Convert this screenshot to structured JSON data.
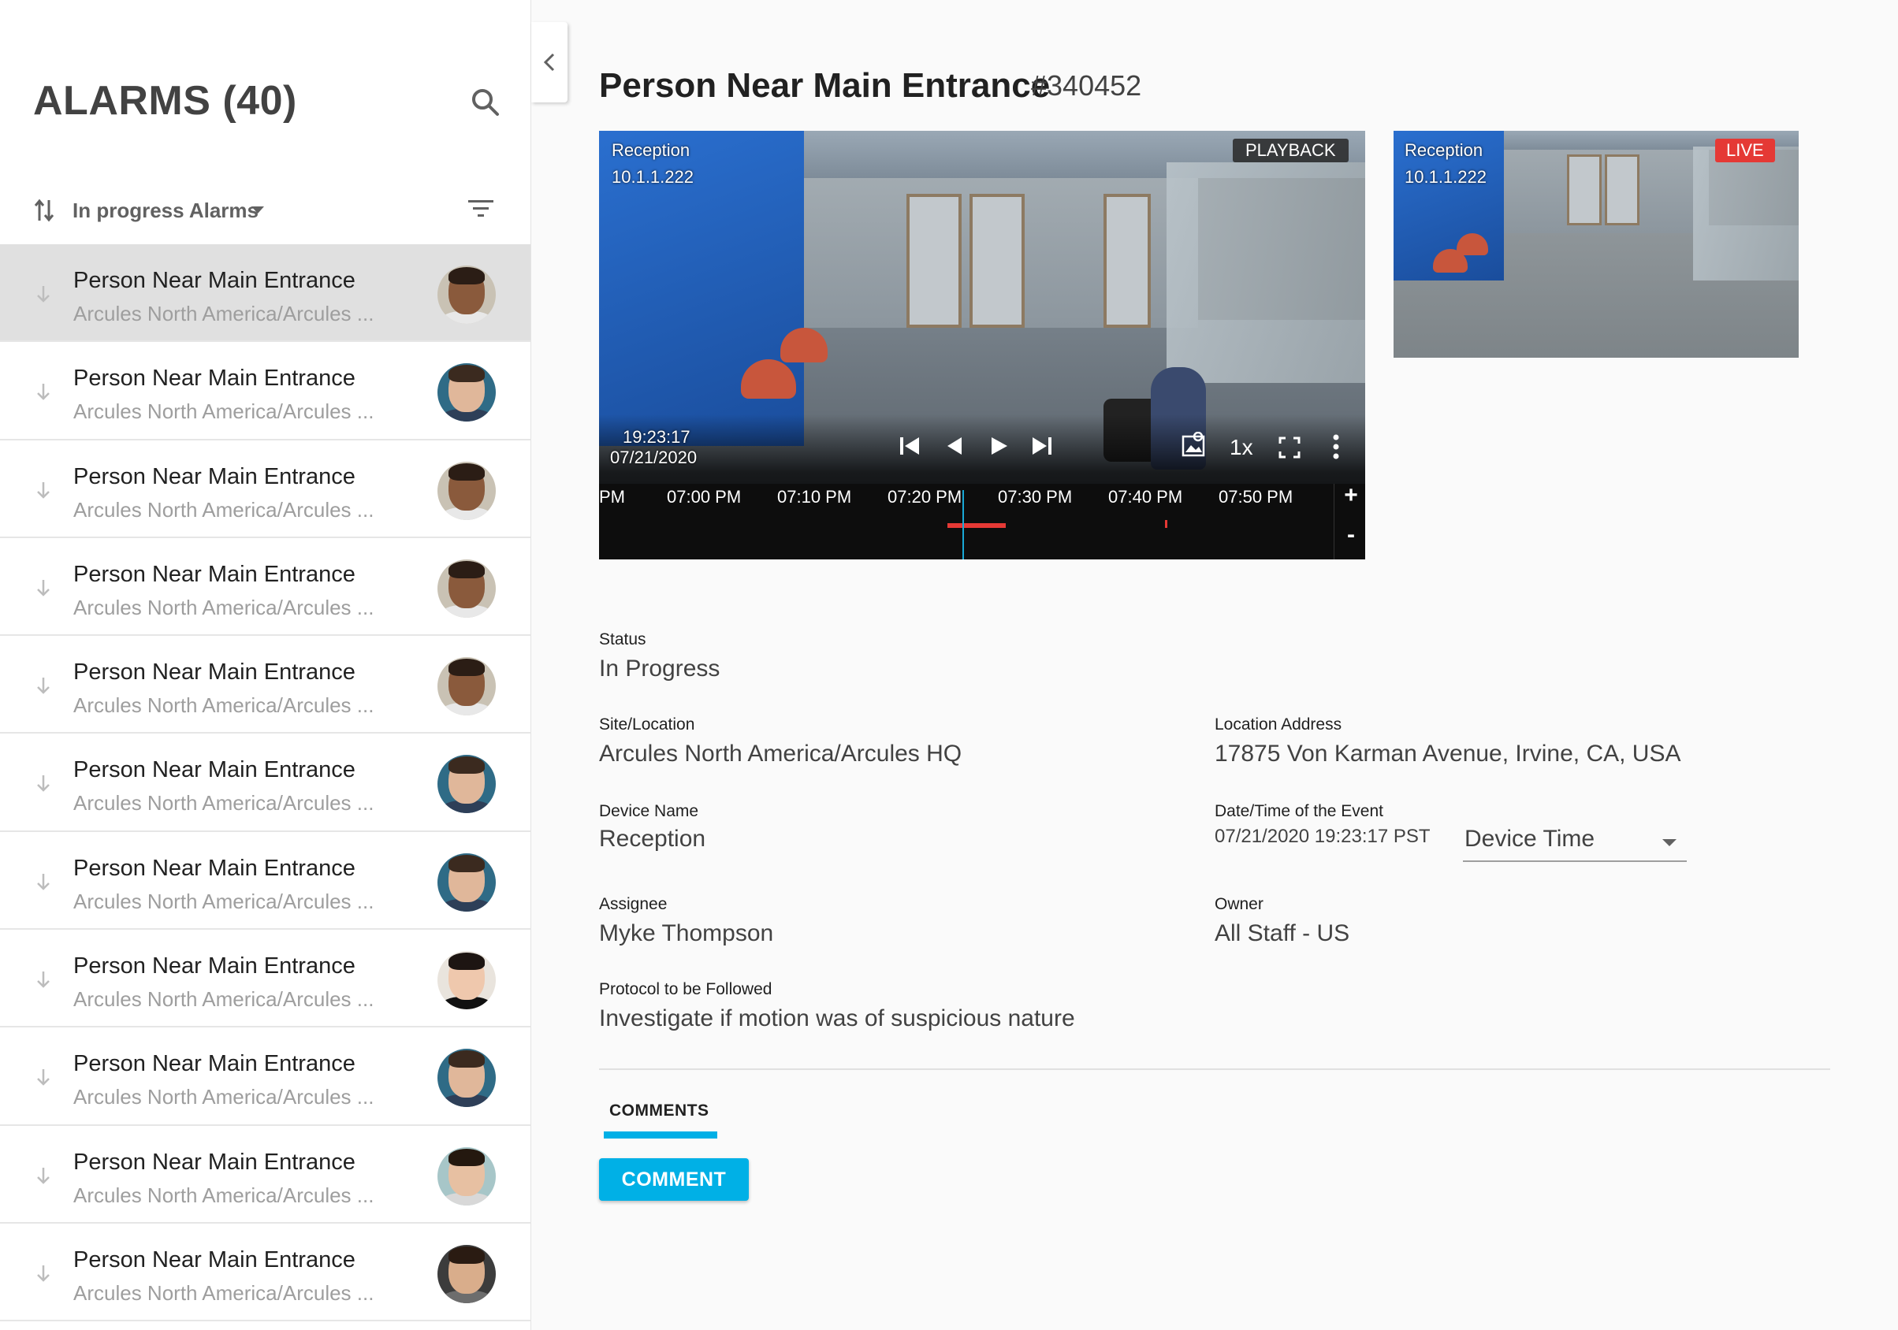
{
  "sidebar": {
    "title": "ALARMS (40)",
    "sort_label": "In progress Alarms",
    "icons": {
      "search": "search-icon",
      "sort": "sort-arrows-icon",
      "filter": "filter-icon",
      "row": "arrow-down-icon"
    },
    "alarms": [
      {
        "title": "Person Near Main Entrance",
        "subtitle": "Arcules North America/Arcules ...",
        "avatar": "avatar-a",
        "selected": true
      },
      {
        "title": "Person Near Main Entrance",
        "subtitle": "Arcules North America/Arcules ...",
        "avatar": "avatar-b"
      },
      {
        "title": "Person Near Main Entrance",
        "subtitle": "Arcules North America/Arcules ...",
        "avatar": "avatar-a"
      },
      {
        "title": "Person Near Main Entrance",
        "subtitle": "Arcules North America/Arcules ...",
        "avatar": "avatar-a"
      },
      {
        "title": "Person Near Main Entrance",
        "subtitle": "Arcules North America/Arcules ...",
        "avatar": "avatar-a"
      },
      {
        "title": "Person Near Main Entrance",
        "subtitle": "Arcules North America/Arcules ...",
        "avatar": "avatar-b"
      },
      {
        "title": "Person Near Main Entrance",
        "subtitle": "Arcules North America/Arcules ...",
        "avatar": "avatar-b"
      },
      {
        "title": "Person Near Main Entrance",
        "subtitle": "Arcules North America/Arcules ...",
        "avatar": "avatar-c"
      },
      {
        "title": "Person Near Main Entrance",
        "subtitle": "Arcules North America/Arcules ...",
        "avatar": "avatar-b"
      },
      {
        "title": "Person Near Main Entrance",
        "subtitle": "Arcules North America/Arcules ...",
        "avatar": "avatar-d"
      },
      {
        "title": "Person Near Main Entrance",
        "subtitle": "Arcules North America/Arcules ...",
        "avatar": "avatar-e"
      }
    ]
  },
  "alarm": {
    "title": "Person Near Main Entrance",
    "id": "#340452"
  },
  "playback": {
    "camera_name": "Reception",
    "camera_ip": "10.1.1.222",
    "mode": "PLAYBACK",
    "time": "19:23:17",
    "date": "07/21/2020",
    "speed": "1x",
    "timeline_ticks": [
      "PM",
      "07:00 PM",
      "07:10 PM",
      "07:20 PM",
      "07:30 PM",
      "07:40 PM",
      "07:50 PM"
    ],
    "zoom_in": "+",
    "zoom_out": "-"
  },
  "live": {
    "camera_name": "Reception",
    "camera_ip": "10.1.1.222",
    "badge": "LIVE"
  },
  "details": {
    "status_label": "Status",
    "status_value": "In Progress",
    "site_label": "Site/Location",
    "site_value": "Arcules North America/Arcules HQ",
    "address_label": "Location Address",
    "address_value": "17875 Von Karman Avenue, Irvine, CA, USA",
    "device_label": "Device Name",
    "device_value": "Reception",
    "datetime_label": "Date/Time of the Event",
    "datetime_value": "07/21/2020 19:23:17 PST",
    "timezone_selected": "Device Time",
    "assignee_label": "Assignee",
    "assignee_value": "Myke Thompson",
    "owner_label": "Owner",
    "owner_value": "All Staff - US",
    "protocol_label": "Protocol to be Followed",
    "protocol_value": "Investigate if motion was of suspicious nature"
  },
  "comments": {
    "tab_label": "COMMENTS",
    "button_label": "COMMENT"
  },
  "colors": {
    "accent": "#00b0e6",
    "live": "#e53935",
    "selected_row": "#e0e0e0"
  }
}
